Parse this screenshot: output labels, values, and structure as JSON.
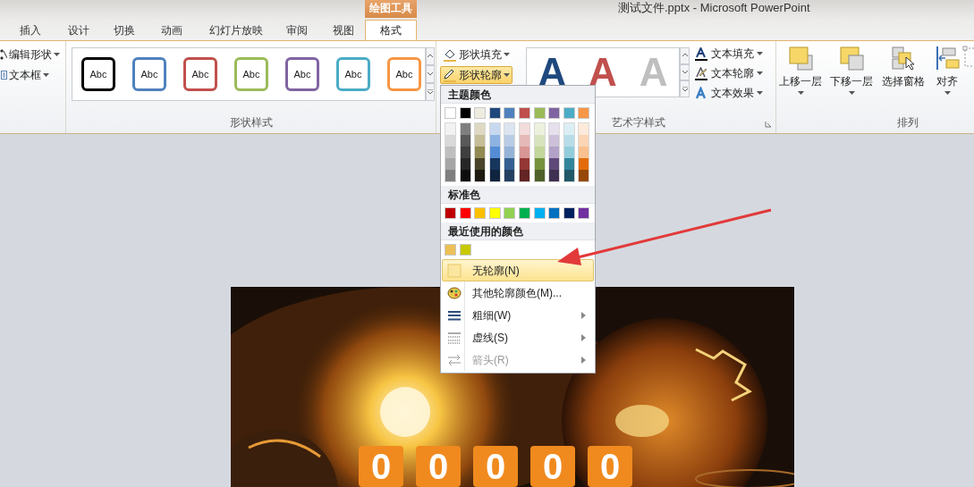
{
  "window": {
    "title": "测试文件.pptx - Microsoft PowerPoint"
  },
  "contextual_tab": {
    "label": "绘图工具"
  },
  "tabs": [
    {
      "label": "插入",
      "selected": false
    },
    {
      "label": "设计",
      "selected": false
    },
    {
      "label": "切换",
      "selected": false
    },
    {
      "label": "动画",
      "selected": false
    },
    {
      "label": "幻灯片放映",
      "selected": false
    },
    {
      "label": "审阅",
      "selected": false
    },
    {
      "label": "视图",
      "selected": false
    },
    {
      "label": "格式",
      "selected": true
    }
  ],
  "insert_group": {
    "buttons": [
      {
        "label": "编辑形状",
        "kind": "edit"
      },
      {
        "label": "文本框",
        "kind": "textbox"
      }
    ]
  },
  "shape_styles": {
    "label": "形状样式",
    "styles": [
      {
        "text": "Abc",
        "color": "#000000"
      },
      {
        "text": "Abc",
        "color": "#4f81bd"
      },
      {
        "text": "Abc",
        "color": "#c0504d"
      },
      {
        "text": "Abc",
        "color": "#9bbb59"
      },
      {
        "text": "Abc",
        "color": "#8064a2"
      },
      {
        "text": "Abc",
        "color": "#4bacc6"
      },
      {
        "text": "Abc",
        "color": "#f79646"
      }
    ]
  },
  "shape_commands": [
    {
      "label": "形状填充",
      "kind": "fill",
      "pressed": false
    },
    {
      "label": "形状轮廓",
      "kind": "outline",
      "pressed": true
    }
  ],
  "wordart_styles": {
    "label": "艺术字样式",
    "styles": [
      {
        "text": "A",
        "color": "#1f497d"
      },
      {
        "text": "A",
        "color": "#c0504d"
      },
      {
        "text": "A",
        "color": "#bfbfbf"
      }
    ]
  },
  "text_commands": [
    {
      "label": "文本填充",
      "kind": "fill"
    },
    {
      "label": "文本轮廓",
      "kind": "outline"
    },
    {
      "label": "文本效果",
      "kind": "effect"
    }
  ],
  "arrange": {
    "label": "排列",
    "buttons": [
      {
        "label": "上移一层",
        "kind": "forward"
      },
      {
        "label": "下移一层",
        "kind": "backward"
      },
      {
        "label": "选择窗格",
        "kind": "pane"
      },
      {
        "label": "对齐",
        "kind": "align"
      },
      {
        "kind": "group"
      }
    ]
  },
  "outline_menu": {
    "theme_heading": "主题颜色",
    "theme_colors": [
      {
        "color": "#ffffff",
        "shades": [
          {
            "color": "#f2f2f2"
          },
          {
            "color": "#d9d9d9"
          },
          {
            "color": "#bfbfbf"
          },
          {
            "color": "#a6a6a6"
          },
          {
            "color": "#808080"
          }
        ]
      },
      {
        "color": "#000000",
        "shades": [
          {
            "color": "#7f7f7f"
          },
          {
            "color": "#595959"
          },
          {
            "color": "#3f3f3f"
          },
          {
            "color": "#262626"
          },
          {
            "color": "#0d0d0d"
          }
        ]
      },
      {
        "color": "#eeece1",
        "shades": [
          {
            "color": "#ddd9c3"
          },
          {
            "color": "#c4bd97"
          },
          {
            "color": "#938953"
          },
          {
            "color": "#494429"
          },
          {
            "color": "#1d1b10"
          }
        ]
      },
      {
        "color": "#1f497d",
        "shades": [
          {
            "color": "#c6d9f0"
          },
          {
            "color": "#8db3e2"
          },
          {
            "color": "#548dd4"
          },
          {
            "color": "#17365d"
          },
          {
            "color": "#0f243e"
          }
        ]
      },
      {
        "color": "#4f81bd",
        "shades": [
          {
            "color": "#dbe5f1"
          },
          {
            "color": "#b8cce4"
          },
          {
            "color": "#95b3d7"
          },
          {
            "color": "#366092"
          },
          {
            "color": "#244061"
          }
        ]
      },
      {
        "color": "#c0504d",
        "shades": [
          {
            "color": "#f2dcdb"
          },
          {
            "color": "#e5b9b7"
          },
          {
            "color": "#d99694"
          },
          {
            "color": "#953734"
          },
          {
            "color": "#632423"
          }
        ]
      },
      {
        "color": "#9bbb59",
        "shades": [
          {
            "color": "#ebf1dd"
          },
          {
            "color": "#d7e3bc"
          },
          {
            "color": "#c3d69b"
          },
          {
            "color": "#76923c"
          },
          {
            "color": "#4f6128"
          }
        ]
      },
      {
        "color": "#8064a2",
        "shades": [
          {
            "color": "#e5e0ec"
          },
          {
            "color": "#ccc1d9"
          },
          {
            "color": "#b2a2c7"
          },
          {
            "color": "#5f497a"
          },
          {
            "color": "#3f3151"
          }
        ]
      },
      {
        "color": "#4bacc6",
        "shades": [
          {
            "color": "#dbeef3"
          },
          {
            "color": "#b7dde8"
          },
          {
            "color": "#92cddc"
          },
          {
            "color": "#31859b"
          },
          {
            "color": "#205867"
          }
        ]
      },
      {
        "color": "#f79646",
        "shades": [
          {
            "color": "#fdeada"
          },
          {
            "color": "#fbd5b5"
          },
          {
            "color": "#fac08f"
          },
          {
            "color": "#e36c09"
          },
          {
            "color": "#974806"
          }
        ]
      }
    ],
    "standard_heading": "标准色",
    "standard_colors": [
      {
        "color": "#c00000"
      },
      {
        "color": "#ff0000"
      },
      {
        "color": "#ffc000"
      },
      {
        "color": "#ffff00"
      },
      {
        "color": "#92d050"
      },
      {
        "color": "#00b050"
      },
      {
        "color": "#00b0f0"
      },
      {
        "color": "#0070c0"
      },
      {
        "color": "#002060"
      },
      {
        "color": "#7030a0"
      }
    ],
    "recent_heading": "最近使用的颜色",
    "recent_colors": [
      {
        "color": "#ecc057"
      },
      {
        "color": "#c8c800"
      }
    ],
    "items": [
      {
        "label": "无轮廓(N)",
        "kind": "none",
        "selected": true,
        "disabled": false,
        "submenu": false
      },
      {
        "label": "其他轮廓颜色(M)...",
        "kind": "palette",
        "selected": false,
        "disabled": false,
        "submenu": false
      },
      {
        "label": "粗细(W)",
        "kind": "weight",
        "selected": false,
        "disabled": false,
        "submenu": true
      },
      {
        "label": "虚线(S)",
        "kind": "dash",
        "selected": false,
        "disabled": false,
        "submenu": true
      },
      {
        "label": "箭头(R)",
        "kind": "arrows",
        "selected": false,
        "disabled": true,
        "submenu": true
      }
    ]
  },
  "slide": {
    "kind": "picture",
    "counter": [
      "0",
      "0",
      "0",
      "0",
      "0"
    ]
  }
}
